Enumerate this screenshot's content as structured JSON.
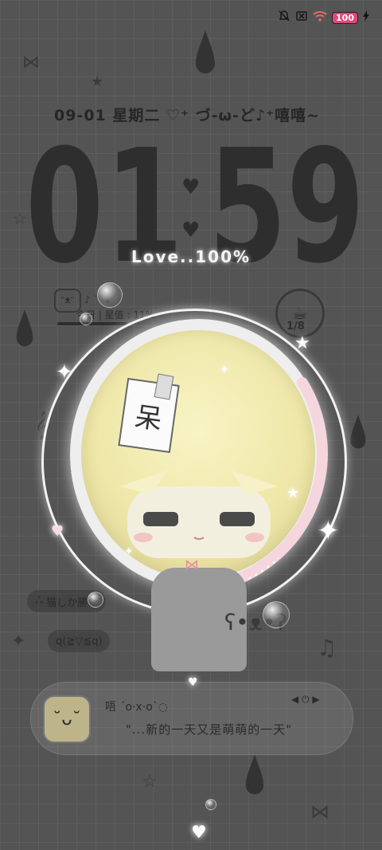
{
  "status": {
    "mute_icon": "bell-off-icon",
    "sim_icon": "no-sim-icon",
    "wifi_icon": "wifi-icon",
    "battery_level": "100",
    "charging_icon": "bolt-icon",
    "battery_color": "#e6467a"
  },
  "lockscreen": {
    "date_line": "09-01 星期二 ♡⁺ づ-ω-ど♪⁺嘻嘻~",
    "time_digits": [
      "0",
      "1",
      "5",
      "9"
    ],
    "love_text": "Love..100%",
    "love_percent": 100
  },
  "widgets": {
    "counter_text": "♪ ˙˙ ₒ",
    "today_label": "今日 | 星值 : 11%",
    "cup_count": "1/8"
  },
  "labels": {
    "bubble_text": "猫しか勝た",
    "face_text": "q(≧▽≦q)",
    "note_card_char": "呆"
  },
  "music": {
    "line1": "唔 ˊo·x·oˋ◌",
    "line2": "\"...新的一天又是萌萌的一天\"",
    "controls": "◀ ⏻ ▶"
  }
}
